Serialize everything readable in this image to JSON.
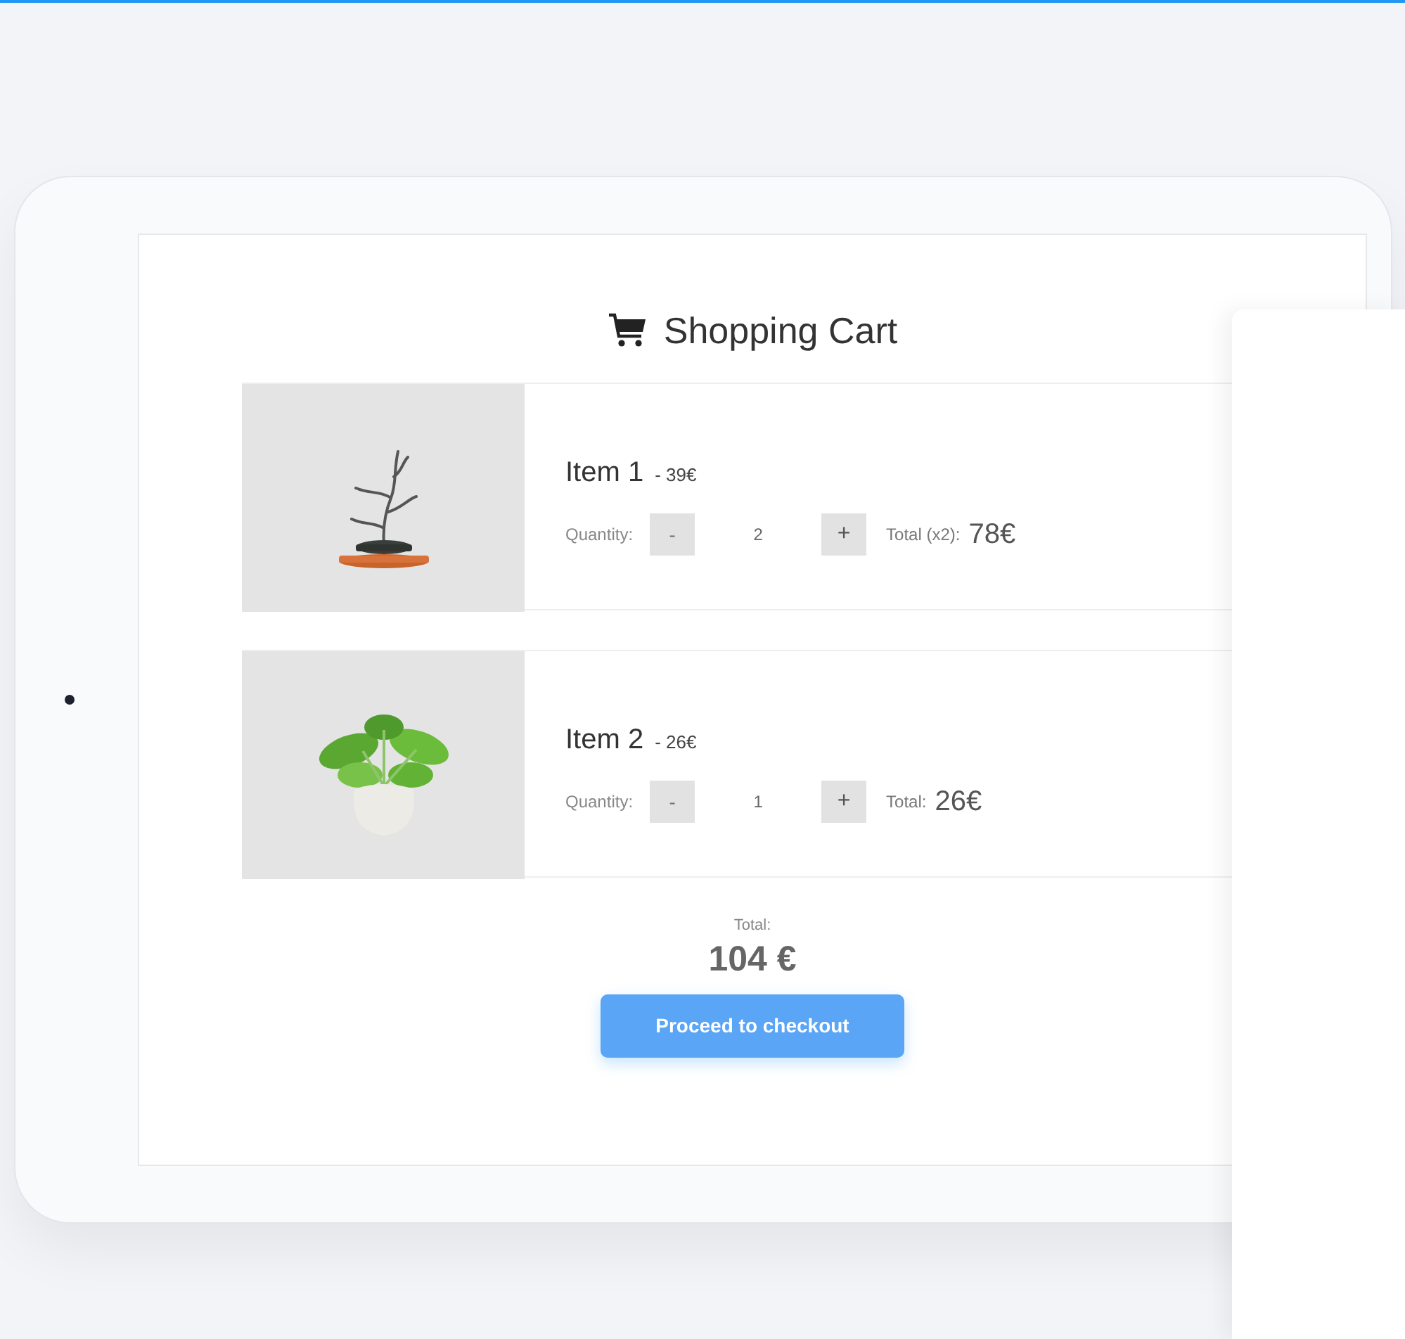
{
  "cart": {
    "title": "Shopping Cart",
    "items": [
      {
        "kind": "bonsai",
        "name": "Item 1",
        "price": "- 39€",
        "quantity_label": "Quantity:",
        "minus": "-",
        "quantity": "2",
        "plus": "+",
        "total_label": "Total (x2):",
        "total": "78€"
      },
      {
        "kind": "pot-plant",
        "name": "Item 2",
        "price": "- 26€",
        "quantity_label": "Quantity:",
        "minus": "-",
        "quantity": "1",
        "plus": "+",
        "total_label": "Total:",
        "total": "26€"
      }
    ],
    "summary": {
      "label": "Total:",
      "amount": "104 €"
    },
    "checkout_button": "Proceed to checkout"
  }
}
